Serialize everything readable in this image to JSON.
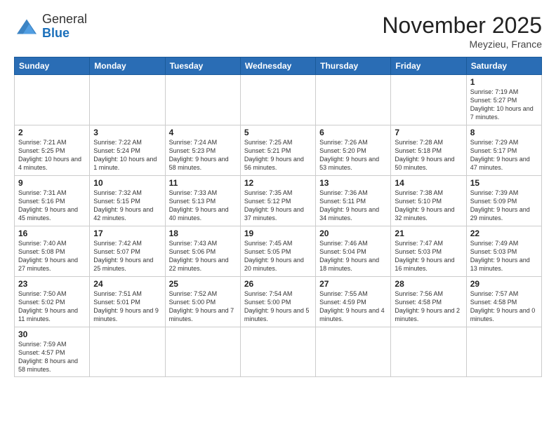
{
  "header": {
    "logo_general": "General",
    "logo_blue": "Blue",
    "month_title": "November 2025",
    "location": "Meyzieu, France"
  },
  "weekdays": [
    "Sunday",
    "Monday",
    "Tuesday",
    "Wednesday",
    "Thursday",
    "Friday",
    "Saturday"
  ],
  "weeks": [
    [
      {
        "day": "",
        "info": ""
      },
      {
        "day": "",
        "info": ""
      },
      {
        "day": "",
        "info": ""
      },
      {
        "day": "",
        "info": ""
      },
      {
        "day": "",
        "info": ""
      },
      {
        "day": "",
        "info": ""
      },
      {
        "day": "1",
        "info": "Sunrise: 7:19 AM\nSunset: 5:27 PM\nDaylight: 10 hours and 7 minutes."
      }
    ],
    [
      {
        "day": "2",
        "info": "Sunrise: 7:21 AM\nSunset: 5:25 PM\nDaylight: 10 hours and 4 minutes."
      },
      {
        "day": "3",
        "info": "Sunrise: 7:22 AM\nSunset: 5:24 PM\nDaylight: 10 hours and 1 minute."
      },
      {
        "day": "4",
        "info": "Sunrise: 7:24 AM\nSunset: 5:23 PM\nDaylight: 9 hours and 58 minutes."
      },
      {
        "day": "5",
        "info": "Sunrise: 7:25 AM\nSunset: 5:21 PM\nDaylight: 9 hours and 56 minutes."
      },
      {
        "day": "6",
        "info": "Sunrise: 7:26 AM\nSunset: 5:20 PM\nDaylight: 9 hours and 53 minutes."
      },
      {
        "day": "7",
        "info": "Sunrise: 7:28 AM\nSunset: 5:18 PM\nDaylight: 9 hours and 50 minutes."
      },
      {
        "day": "8",
        "info": "Sunrise: 7:29 AM\nSunset: 5:17 PM\nDaylight: 9 hours and 47 minutes."
      }
    ],
    [
      {
        "day": "9",
        "info": "Sunrise: 7:31 AM\nSunset: 5:16 PM\nDaylight: 9 hours and 45 minutes."
      },
      {
        "day": "10",
        "info": "Sunrise: 7:32 AM\nSunset: 5:15 PM\nDaylight: 9 hours and 42 minutes."
      },
      {
        "day": "11",
        "info": "Sunrise: 7:33 AM\nSunset: 5:13 PM\nDaylight: 9 hours and 40 minutes."
      },
      {
        "day": "12",
        "info": "Sunrise: 7:35 AM\nSunset: 5:12 PM\nDaylight: 9 hours and 37 minutes."
      },
      {
        "day": "13",
        "info": "Sunrise: 7:36 AM\nSunset: 5:11 PM\nDaylight: 9 hours and 34 minutes."
      },
      {
        "day": "14",
        "info": "Sunrise: 7:38 AM\nSunset: 5:10 PM\nDaylight: 9 hours and 32 minutes."
      },
      {
        "day": "15",
        "info": "Sunrise: 7:39 AM\nSunset: 5:09 PM\nDaylight: 9 hours and 29 minutes."
      }
    ],
    [
      {
        "day": "16",
        "info": "Sunrise: 7:40 AM\nSunset: 5:08 PM\nDaylight: 9 hours and 27 minutes."
      },
      {
        "day": "17",
        "info": "Sunrise: 7:42 AM\nSunset: 5:07 PM\nDaylight: 9 hours and 25 minutes."
      },
      {
        "day": "18",
        "info": "Sunrise: 7:43 AM\nSunset: 5:06 PM\nDaylight: 9 hours and 22 minutes."
      },
      {
        "day": "19",
        "info": "Sunrise: 7:45 AM\nSunset: 5:05 PM\nDaylight: 9 hours and 20 minutes."
      },
      {
        "day": "20",
        "info": "Sunrise: 7:46 AM\nSunset: 5:04 PM\nDaylight: 9 hours and 18 minutes."
      },
      {
        "day": "21",
        "info": "Sunrise: 7:47 AM\nSunset: 5:03 PM\nDaylight: 9 hours and 16 minutes."
      },
      {
        "day": "22",
        "info": "Sunrise: 7:49 AM\nSunset: 5:03 PM\nDaylight: 9 hours and 13 minutes."
      }
    ],
    [
      {
        "day": "23",
        "info": "Sunrise: 7:50 AM\nSunset: 5:02 PM\nDaylight: 9 hours and 11 minutes."
      },
      {
        "day": "24",
        "info": "Sunrise: 7:51 AM\nSunset: 5:01 PM\nDaylight: 9 hours and 9 minutes."
      },
      {
        "day": "25",
        "info": "Sunrise: 7:52 AM\nSunset: 5:00 PM\nDaylight: 9 hours and 7 minutes."
      },
      {
        "day": "26",
        "info": "Sunrise: 7:54 AM\nSunset: 5:00 PM\nDaylight: 9 hours and 5 minutes."
      },
      {
        "day": "27",
        "info": "Sunrise: 7:55 AM\nSunset: 4:59 PM\nDaylight: 9 hours and 4 minutes."
      },
      {
        "day": "28",
        "info": "Sunrise: 7:56 AM\nSunset: 4:58 PM\nDaylight: 9 hours and 2 minutes."
      },
      {
        "day": "29",
        "info": "Sunrise: 7:57 AM\nSunset: 4:58 PM\nDaylight: 9 hours and 0 minutes."
      }
    ],
    [
      {
        "day": "30",
        "info": "Sunrise: 7:59 AM\nSunset: 4:57 PM\nDaylight: 8 hours and 58 minutes."
      },
      {
        "day": "",
        "info": ""
      },
      {
        "day": "",
        "info": ""
      },
      {
        "day": "",
        "info": ""
      },
      {
        "day": "",
        "info": ""
      },
      {
        "day": "",
        "info": ""
      },
      {
        "day": "",
        "info": ""
      }
    ]
  ]
}
